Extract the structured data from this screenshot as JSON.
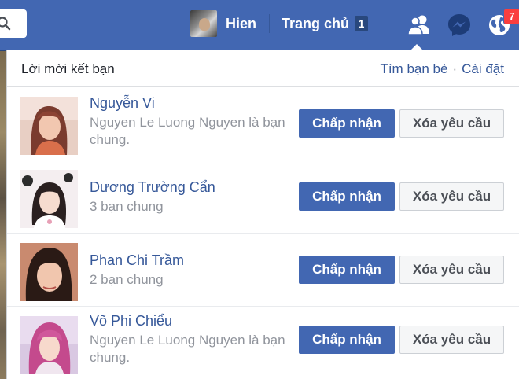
{
  "topbar": {
    "profile_name": "Hien",
    "home_label": "Trang chủ",
    "home_count": "1",
    "notification_count": "7",
    "icons": [
      "search-icon",
      "friends-icon",
      "messenger-icon",
      "globe-icon"
    ]
  },
  "panel": {
    "title": "Lời mời kết bạn",
    "find_friends_link": "Tìm bạn bè",
    "separator": "·",
    "settings_link": "Cài đặt"
  },
  "requests": [
    {
      "name": "Nguyễn Vi",
      "mutual": "Nguyen Le Luong Nguyen là bạn chung.",
      "accept": "Chấp nhận",
      "delete": "Xóa yêu cầu"
    },
    {
      "name": "Dương Trường Cẩn",
      "mutual": "3 bạn chung",
      "accept": "Chấp nhận",
      "delete": "Xóa yêu cầu"
    },
    {
      "name": "Phan Chi Trầm",
      "mutual": "2 bạn chung",
      "accept": "Chấp nhận",
      "delete": "Xóa yêu cầu"
    },
    {
      "name": "Võ Phi Chiểu",
      "mutual": "Nguyen Le Luong Nguyen là bạn chung.",
      "accept": "Chấp nhận",
      "delete": "Xóa yêu cầu"
    }
  ],
  "colors": {
    "brand": "#4267b2",
    "link": "#365899",
    "badge": "#fa3e3e"
  }
}
